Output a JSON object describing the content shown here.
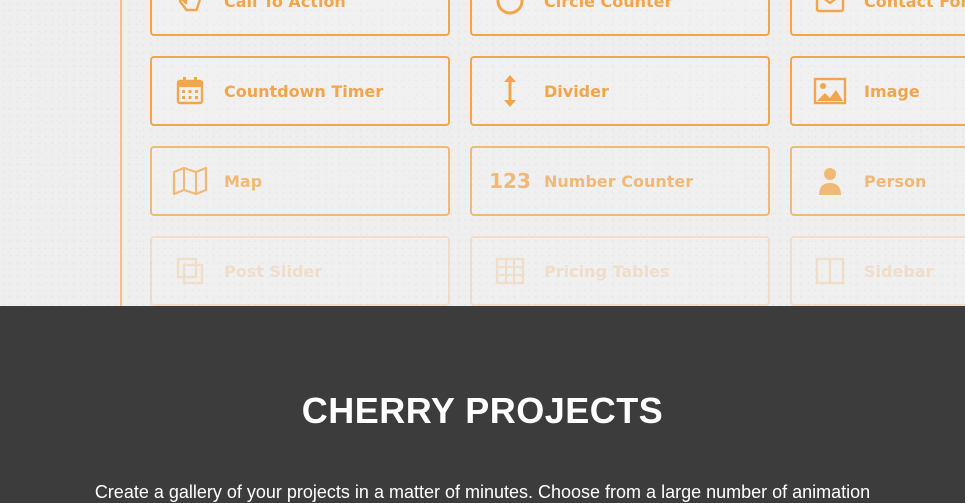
{
  "modules": [
    {
      "label": "Call To Action",
      "icon": "hand-pointer-icon"
    },
    {
      "label": "Circle Counter",
      "icon": "circle-icon"
    },
    {
      "label": "Contact Form",
      "icon": "envelope-icon"
    },
    {
      "label": "Countdown Timer",
      "icon": "calendar-icon"
    },
    {
      "label": "Divider",
      "icon": "vertical-arrows-icon"
    },
    {
      "label": "Image",
      "icon": "image-icon"
    },
    {
      "label": "Map",
      "icon": "map-icon"
    },
    {
      "label": "Number Counter",
      "icon": "number-123-icon",
      "icon_text": "123"
    },
    {
      "label": "Person",
      "icon": "person-icon"
    },
    {
      "label": "Post Slider",
      "icon": "copy-icon"
    },
    {
      "label": "Pricing Tables",
      "icon": "table-icon"
    },
    {
      "label": "Sidebar",
      "icon": "sidebar-icon"
    }
  ],
  "section": {
    "title": "CHERRY PROJECTS",
    "text": "Create a gallery of your projects in a matter of minutes. Choose from a large number of animation"
  },
  "colors": {
    "accent": "#f2a54a",
    "hero_bg": "#efefef",
    "dark_bg": "#3c3c3c",
    "text_light": "#ffffff"
  }
}
